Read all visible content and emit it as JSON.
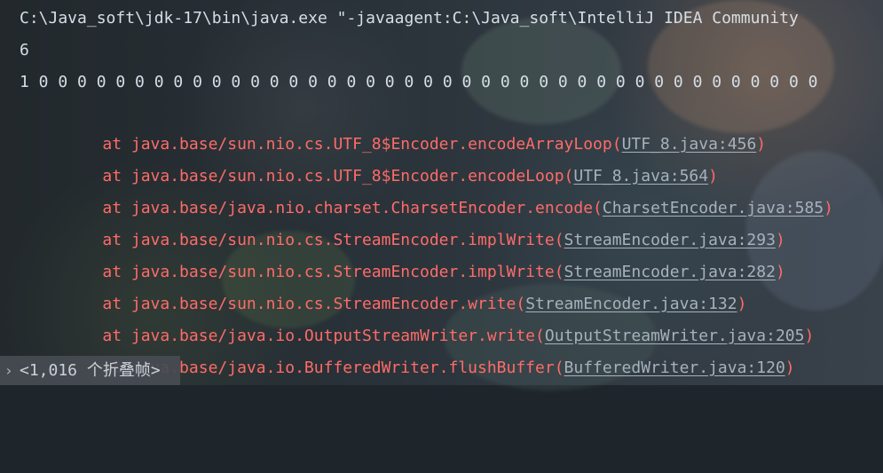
{
  "console": {
    "command": "C:\\Java_soft\\jdk-17\\bin\\java.exe \"-javaagent:C:\\Java_soft\\IntelliJ IDEA Community",
    "output_lines": [
      "6",
      "1 0 0 0 0 0 0 0 0 0 0 0 0 0 0 0 0 0 0 0 0 0 0 0 0 0 0 0 0 0 0 0 0 0 0 0 0 0 0 0 0 0"
    ],
    "stack_trace": [
      {
        "prefix": "at java.base/sun.nio.cs.UTF_8$Encoder.encodeArrayLoop(",
        "link": "UTF_8.java:456",
        "suffix": ")"
      },
      {
        "prefix": "at java.base/sun.nio.cs.UTF_8$Encoder.encodeLoop(",
        "link": "UTF_8.java:564",
        "suffix": ")"
      },
      {
        "prefix": "at java.base/java.nio.charset.CharsetEncoder.encode(",
        "link": "CharsetEncoder.java:585",
        "suffix": ")"
      },
      {
        "prefix": "at java.base/sun.nio.cs.StreamEncoder.implWrite(",
        "link": "StreamEncoder.java:293",
        "suffix": ")"
      },
      {
        "prefix": "at java.base/sun.nio.cs.StreamEncoder.implWrite(",
        "link": "StreamEncoder.java:282",
        "suffix": ")"
      },
      {
        "prefix": "at java.base/sun.nio.cs.StreamEncoder.write(",
        "link": "StreamEncoder.java:132",
        "suffix": ")"
      },
      {
        "prefix": "at java.base/java.io.OutputStreamWriter.write(",
        "link": "OutputStreamWriter.java:205",
        "suffix": ")"
      },
      {
        "prefix": "at java.base/java.io.BufferedWriter.flushBuffer(",
        "link": "BufferedWriter.java:120",
        "suffix": ")"
      }
    ],
    "folded_frames_label": "<1,016 个折叠帧>",
    "folded_frames_icon": "chevron-right-icon",
    "colors": {
      "normal_text": "#d7dee7",
      "error_text": "#ff6b68",
      "link_text": "#a7b1bc"
    }
  }
}
